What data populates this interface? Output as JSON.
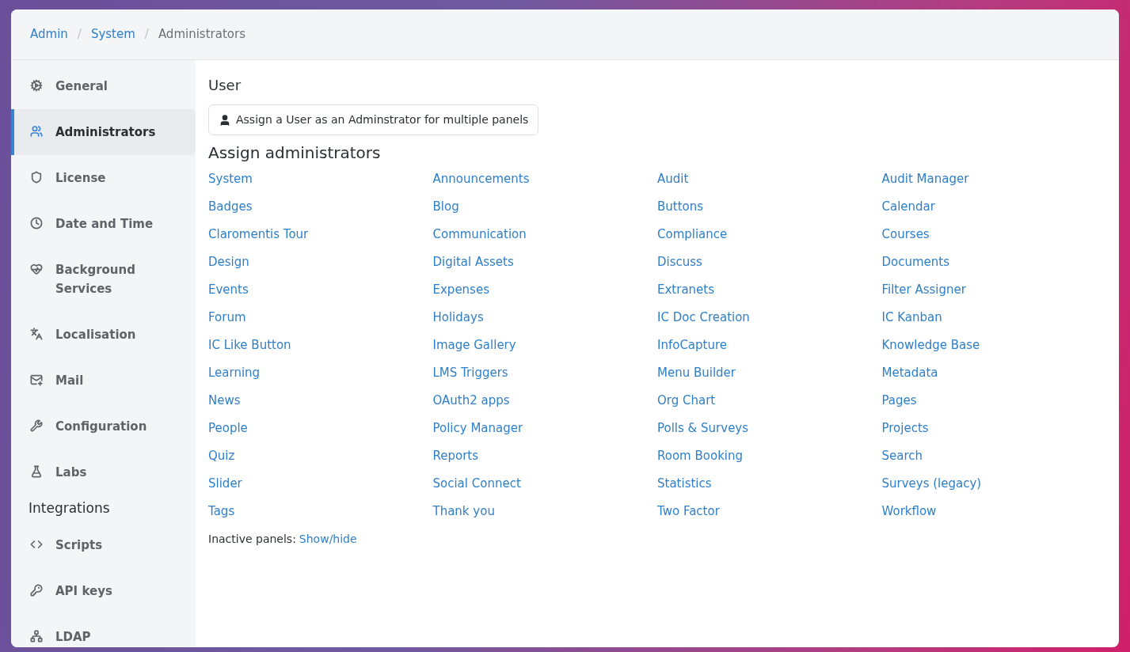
{
  "breadcrumb": [
    {
      "label": "Admin",
      "kind": "link"
    },
    {
      "label": "/",
      "kind": "separator"
    },
    {
      "label": "System",
      "kind": "link"
    },
    {
      "label": "/",
      "kind": "separator"
    },
    {
      "label": "Administrators",
      "kind": "current"
    }
  ],
  "sidebar": {
    "items": [
      {
        "label": "General",
        "selected": false
      },
      {
        "label": "Administrators",
        "selected": true
      },
      {
        "label": "License",
        "selected": false
      },
      {
        "label": "Date and Time",
        "selected": false
      },
      {
        "label": "Background Services",
        "selected": false
      },
      {
        "label": "Localisation",
        "selected": false
      },
      {
        "label": "Mail",
        "selected": false
      },
      {
        "label": "Configuration",
        "selected": false
      },
      {
        "label": "Labs",
        "selected": false
      }
    ],
    "heading": "Integrations",
    "integrations": [
      {
        "label": "Scripts",
        "selected": false
      },
      {
        "label": "API keys",
        "selected": false
      },
      {
        "label": "LDAP",
        "selected": false
      }
    ]
  },
  "user_section": {
    "title": "User",
    "button": "Assign a User as an Adminstrator for multiple panels"
  },
  "assign_section": {
    "title": "Assign administrators",
    "panels": [
      "System",
      "Announcements",
      "Audit",
      "Audit Manager",
      "Badges",
      "Blog",
      "Buttons",
      "Calendar",
      "Claromentis Tour",
      "Communication",
      "Compliance",
      "Courses",
      "Design",
      "Digital Assets",
      "Discuss",
      "Documents",
      "Events",
      "Expenses",
      "Extranets",
      "Filter Assigner",
      "Forum",
      "Holidays",
      "IC Doc Creation",
      "IC Kanban",
      "IC Like Button",
      "Image Gallery",
      "InfoCapture",
      "Knowledge Base",
      "Learning",
      "LMS Triggers",
      "Menu Builder",
      "Metadata",
      "News",
      "OAuth2 apps",
      "Org Chart",
      "Pages",
      "People",
      "Policy Manager",
      "Polls & Surveys",
      "Projects",
      "Quiz",
      "Reports",
      "Room Booking",
      "Search",
      "Slider",
      "Social Connect",
      "Statistics",
      "Surveys (legacy)",
      "Tags",
      "Thank you",
      "Two Factor",
      "Workflow"
    ],
    "inactive_label": "Inactive panels:",
    "inactive_link": "Show/hide"
  }
}
